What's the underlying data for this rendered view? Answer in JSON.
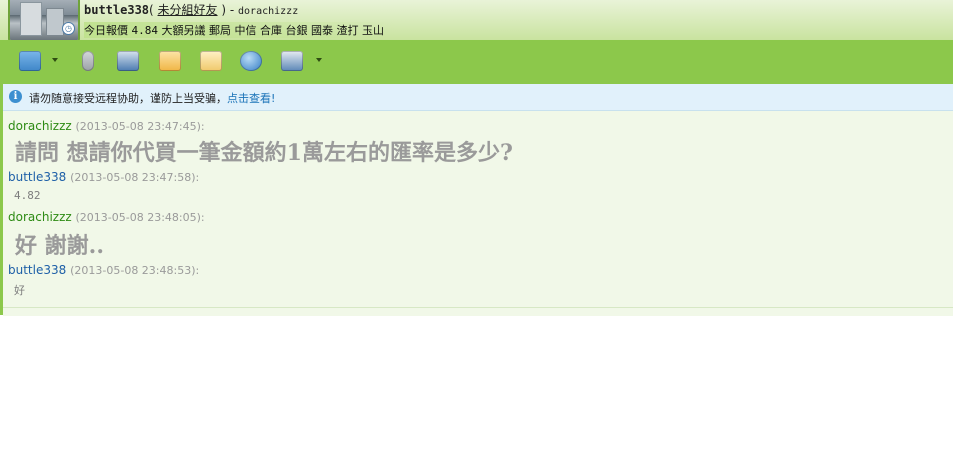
{
  "header": {
    "username": "buttle338",
    "group_open": "( ",
    "group": "未分組好友",
    "group_close": " )",
    "sep": " - ",
    "nickname": "dorachizzz",
    "status_prefix": "今日報價 ",
    "status_rate": "4.84",
    "status_rest": " 大額另議 郵局 中信 合庫 台銀 國泰 渣打 玉山"
  },
  "toolbar": {
    "items": [
      {
        "name": "send-file-icon",
        "color": "#3f86c8"
      },
      {
        "name": "voice-microphone-icon",
        "color": "#9aa0a6"
      },
      {
        "name": "video-camera-icon",
        "color": "#4a7ab0"
      },
      {
        "name": "group-chat-icon",
        "color": "#f0b545"
      },
      {
        "name": "email-icon",
        "color": "#f0c96b"
      },
      {
        "name": "browser-globe-icon",
        "color": "#2f79c3"
      },
      {
        "name": "remote-assist-icon",
        "color": "#5c87b7"
      }
    ]
  },
  "notice": {
    "text": "请勿随意接受远程协助，谨防上当受骗，",
    "link": "点击查看!"
  },
  "messages": [
    {
      "sender": "dorachizzz",
      "time": "(2013-05-08 23:47:45):",
      "body": "請問 想請你代買一筆金額約1萬左右的匯率是多少?"
    },
    {
      "sender": "buttle338",
      "time": "(2013-05-08 23:47:58):",
      "body": "4.82"
    },
    {
      "sender": "dorachizzz",
      "time": "(2013-05-08 23:48:05):",
      "body": "好 謝謝.."
    },
    {
      "sender": "buttle338",
      "time": "(2013-05-08 23:48:53):",
      "body": "好"
    }
  ],
  "colors": {
    "window_green": "#8cc84b",
    "chat_bg": "#f1f8e8",
    "sender_peer": "#2e8b14",
    "sender_self": "#1d5fa7",
    "link": "#1a73b8"
  }
}
